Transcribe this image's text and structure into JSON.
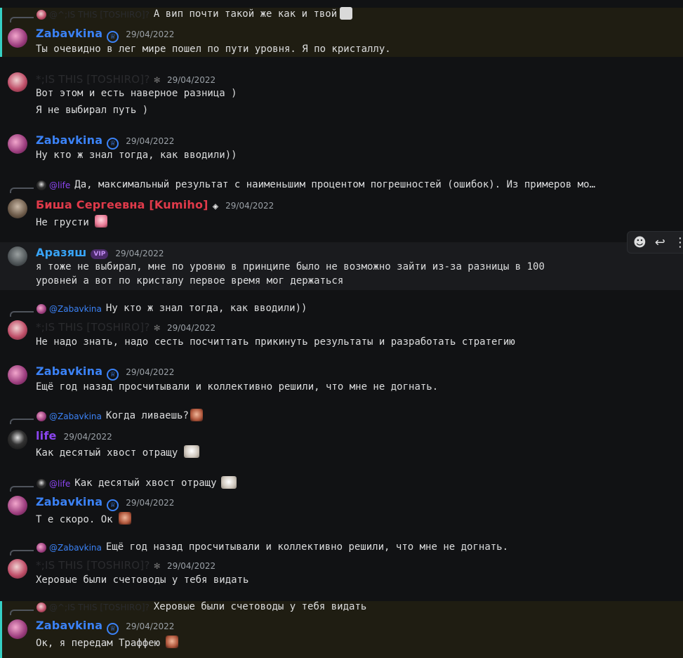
{
  "messages": [
    {
      "reply_to": "@^;IS THIS [TOSHIRO]?",
      "reply_text": "А вип почти такой же как и твой",
      "author": "Zabavkina",
      "time": "29/04/2022",
      "lines": [
        "Ты очевидно в лег мире пошел по пути уровня. Я по кристаллу."
      ]
    },
    {
      "author": "*;IS THIS [TOSHIRO]?",
      "time": "29/04/2022",
      "lines": [
        "Вот этом и есть наверное разница )",
        "Я не выбирал путь )"
      ]
    },
    {
      "author": "Zabavkina",
      "time": "29/04/2022",
      "lines": [
        "Ну кто ж знал тогда, как вводили))"
      ]
    },
    {
      "reply_to": "@life",
      "reply_text": "Да, максимальный результат с наименьшим процентом погрешностей (ошибок). Из примеров мо…",
      "author": "Биша Сергеевна [Kumiho]",
      "time": "29/04/2022",
      "lines": [
        "Не грусти"
      ]
    },
    {
      "author": "Аразяш",
      "badge": "VIP",
      "time": "29/04/2022",
      "lines": [
        "я тоже не выбирал, мне по уровню в принципе было не возможно зайти из-за разницы в 100",
        "уровней а вот по кристалу первое время мог держаться"
      ]
    },
    {
      "reply_to": "@Zabavkina",
      "reply_text": "Ну кто ж знал тогда, как вводили))",
      "author": "*;IS THIS [TOSHIRO]?",
      "time": "29/04/2022",
      "lines": [
        "Не надо знать, надо сесть посчиттать прикинуть результаты и разработать стратегию"
      ]
    },
    {
      "author": "Zabavkina",
      "time": "29/04/2022",
      "lines": [
        "Ещё год назад просчитывали и коллективно решили, что мне не догнать."
      ]
    },
    {
      "reply_to": "@Zabavkina",
      "reply_text": "Когда ливаешь?",
      "author": "life",
      "time": "29/04/2022",
      "lines": [
        "Как десятый хвост отращу"
      ]
    },
    {
      "reply_to": "@life",
      "reply_text": "Как десятый хвост отращу",
      "author": "Zabavkina",
      "time": "29/04/2022",
      "lines": [
        "Т е скоро. Ок"
      ]
    },
    {
      "reply_to": "@Zabavkina",
      "reply_text": "Ещё год назад просчитывали и коллективно решили, что мне не догнать.",
      "author": "*;IS THIS [TOSHIRO]?",
      "time": "29/04/2022",
      "lines": [
        "Херовые были счетоводы у тебя видать"
      ]
    },
    {
      "reply_to": "@^;IS THIS [TOSHIRO]?",
      "reply_text": "Херовые были счетоводы у тебя видать",
      "author": "Zabavkina",
      "time": "29/04/2022",
      "lines": [
        "Ок, я передам Траффею"
      ]
    }
  ],
  "toolbar": {
    "icons": [
      "add-reaction-icon",
      "reply-icon",
      "more-icon"
    ],
    "add_reaction": "☻",
    "reply": "↩",
    "more": "⋮"
  },
  "colors": {
    "background": "#111214",
    "highlight": "#1f1d12",
    "highlight_bar": "#35d0c4",
    "zabavkina": "#3b82f6",
    "kumiho": "#e03a4a",
    "arazyash": "#38a3f5",
    "life": "#8b45f0"
  }
}
